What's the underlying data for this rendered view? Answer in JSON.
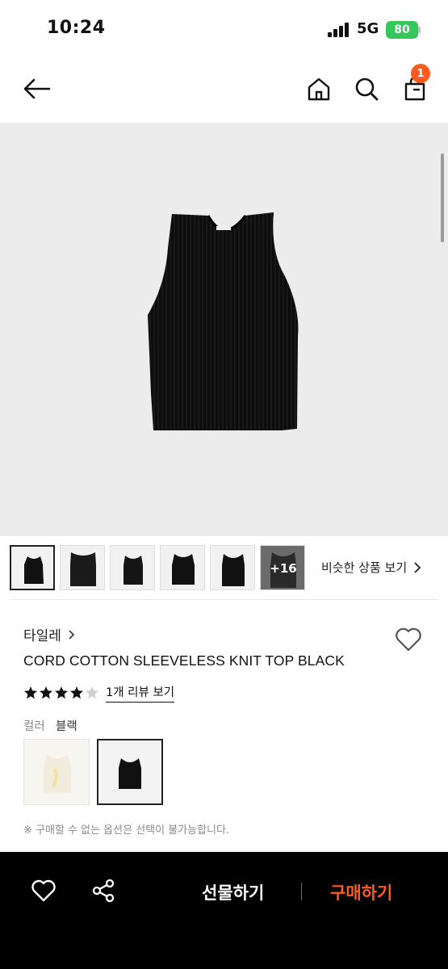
{
  "status_bar": {
    "time": "10:24",
    "network": "5G",
    "battery": "80"
  },
  "nav": {
    "back_icon": "arrow-left-icon",
    "home_icon": "home-icon",
    "search_icon": "search-icon",
    "cart_icon": "shopping-bag-icon",
    "cart_count": "1"
  },
  "gallery": {
    "more_count": "+16",
    "similar_link": "비슷한 상품 보기",
    "similar_chevron": "›"
  },
  "product": {
    "brand": "타일레",
    "brand_chevron": "›",
    "title": "CORD COTTON SLEEVELESS KNIT TOP BLACK",
    "rating": 4,
    "rating_max": 5,
    "review_link": "1개 리뷰 보기"
  },
  "options": {
    "color_label": "컬러",
    "color_value": "블랙",
    "notice": "※ 구매할 수 없는 옵션은 선택이 불가능합니다."
  },
  "bottom_bar": {
    "gift_label": "선물하기",
    "buy_label": "구매하기"
  },
  "colors": {
    "accent": "#ff5a1f",
    "battery": "#34c759",
    "bottom_bar": "#000000"
  }
}
